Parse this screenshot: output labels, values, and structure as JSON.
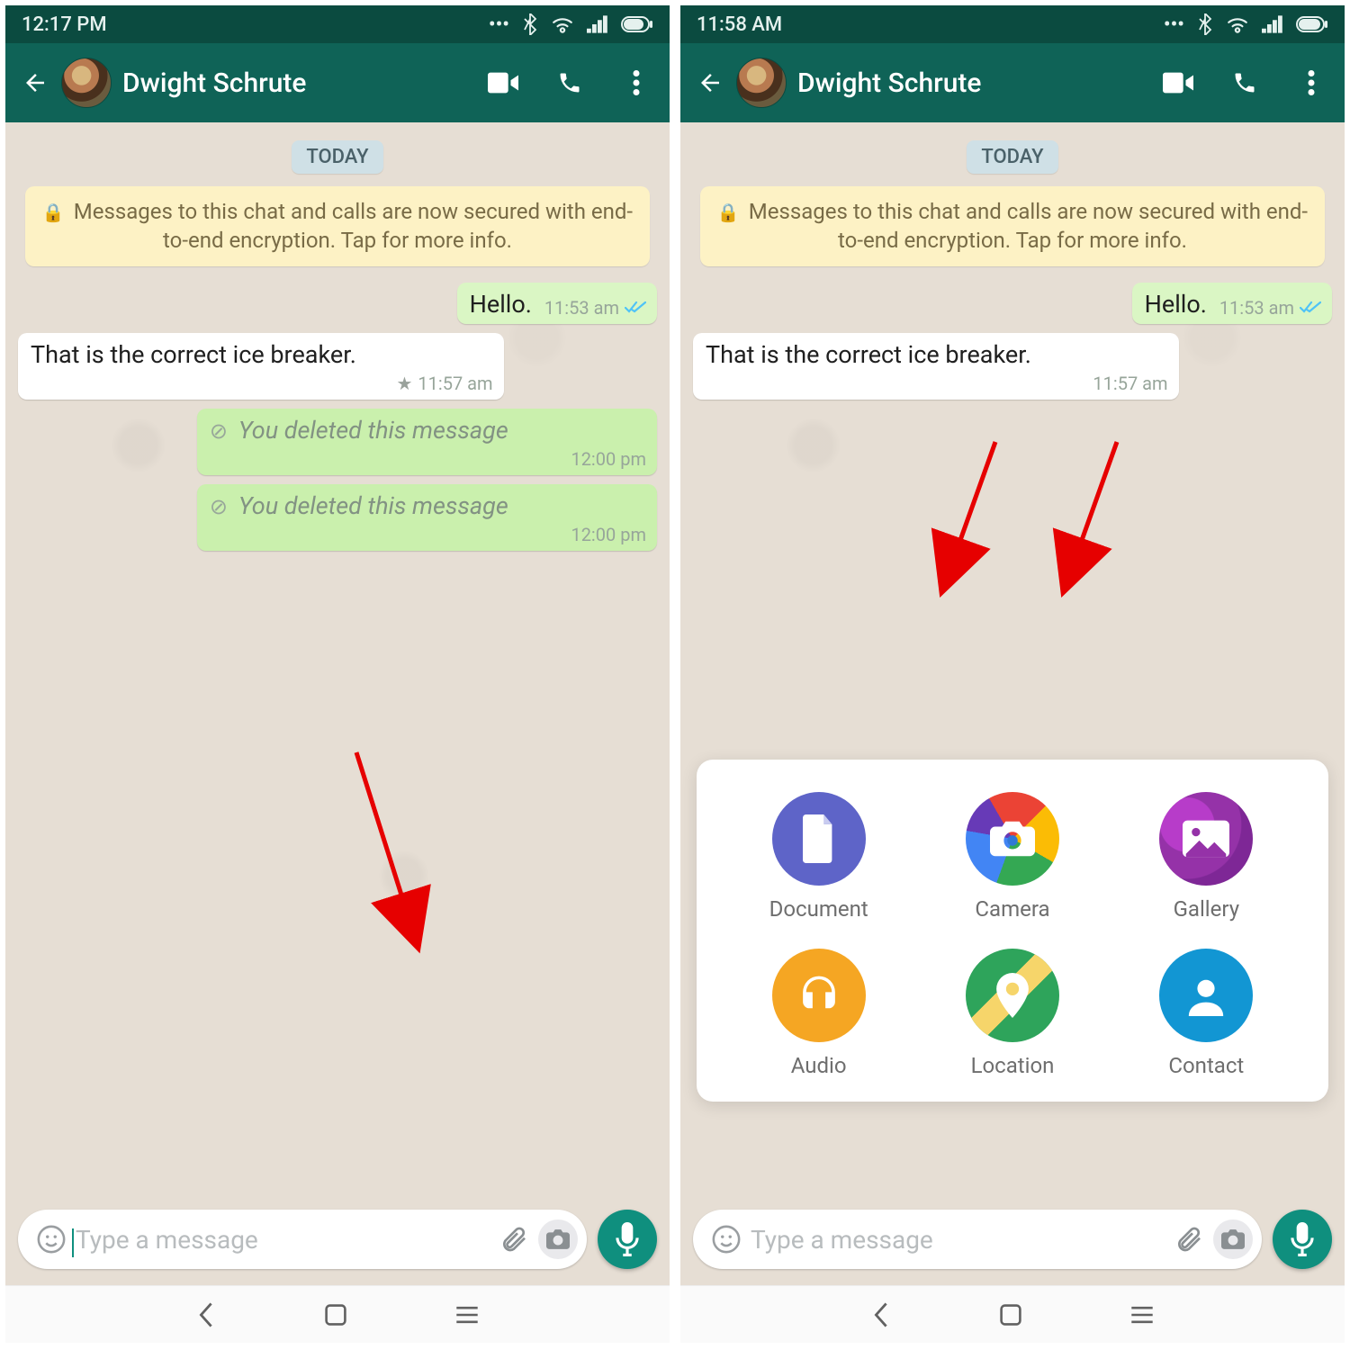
{
  "left": {
    "status_time": "12:17 PM",
    "contact": "Dwight Schrute",
    "date_chip": "TODAY",
    "encryption_text": "Messages to this chat and calls are now secured with end-to-end encryption. Tap for more info.",
    "messages": [
      {
        "side": "out",
        "text": "Hello.",
        "time": "11:53 am",
        "ticks": true,
        "deleted": false
      },
      {
        "side": "in",
        "text": "That is the correct ice breaker.",
        "time": "11:57 am",
        "starred": true,
        "deleted": false
      },
      {
        "side": "out",
        "text": "You deleted this message",
        "time": "12:00 pm",
        "deleted": true
      },
      {
        "side": "out",
        "text": "You deleted this message",
        "time": "12:00 pm",
        "deleted": true
      }
    ],
    "input_placeholder": "Type a message"
  },
  "right": {
    "status_time": "11:58 AM",
    "contact": "Dwight Schrute",
    "date_chip": "TODAY",
    "encryption_text": "Messages to this chat and calls are now secured with end-to-end encryption. Tap for more info.",
    "messages": [
      {
        "side": "out",
        "text": "Hello.",
        "time": "11:53 am",
        "ticks": true,
        "deleted": false
      },
      {
        "side": "in",
        "text": "That is the correct ice breaker.",
        "time": "11:57 am",
        "deleted": false
      }
    ],
    "input_placeholder": "Type a message",
    "attach": {
      "document": "Document",
      "camera": "Camera",
      "gallery": "Gallery",
      "audio": "Audio",
      "location": "Location",
      "contact": "Contact"
    }
  }
}
